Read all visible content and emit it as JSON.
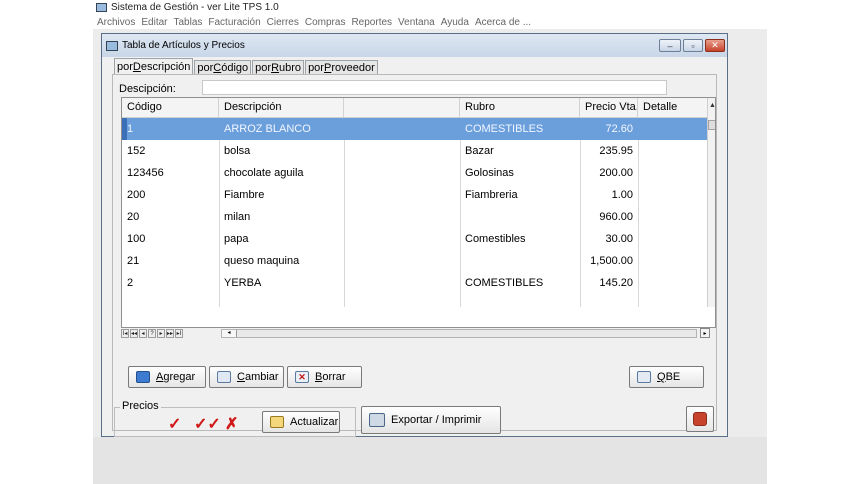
{
  "app": {
    "title": "Sistema de Gestión - ver Lite TPS 1.0",
    "menu": [
      "Archivos",
      "Editar",
      "Tablas",
      "Facturación",
      "Cierres",
      "Compras",
      "Reportes",
      "Ventana",
      "Ayuda",
      "Acerca de ..."
    ]
  },
  "window": {
    "title": "Tabla de Artículos y Precios",
    "controls": {
      "minimize": "–",
      "restore": "▫",
      "close": "✕"
    }
  },
  "tabs": [
    {
      "prefix": "por ",
      "key": "D",
      "rest": "escripción"
    },
    {
      "prefix": "por ",
      "key": "C",
      "rest": "ódigo"
    },
    {
      "prefix": "por ",
      "key": "R",
      "rest": "ubro"
    },
    {
      "prefix": "por ",
      "key": "P",
      "rest": "roveedor"
    }
  ],
  "search": {
    "label": "Descipción:",
    "value": ""
  },
  "table": {
    "columns": [
      "Código",
      "Descripción",
      "",
      "Rubro",
      "Precio Vta.",
      "Detalle"
    ],
    "rows": [
      [
        "1",
        "ARROZ BLANCO",
        "",
        "COMESTIBLES",
        "72.60",
        ""
      ],
      [
        "152",
        "bolsa",
        "",
        "Bazar",
        "235.95",
        ""
      ],
      [
        "123456",
        "chocolate aguila",
        "",
        "Golosinas",
        "200.00",
        ""
      ],
      [
        "200",
        "Fiambre",
        "",
        "Fiambreria",
        "1.00",
        ""
      ],
      [
        "20",
        "milan",
        "",
        "",
        "960.00",
        ""
      ],
      [
        "100",
        "papa",
        "",
        "Comestibles",
        "30.00",
        ""
      ],
      [
        "21",
        "queso maquina",
        "",
        "",
        "1,500.00",
        ""
      ],
      [
        "2",
        "YERBA",
        "",
        "COMESTIBLES",
        "145.20",
        ""
      ]
    ],
    "selected_row": 0
  },
  "navigator": {
    "first": "I◂",
    "prev_page": "◂◂",
    "prev": "◂",
    "record": "?",
    "next": "▸",
    "next_page": "▸▸",
    "last": "▸I"
  },
  "buttons": {
    "agregar": {
      "key": "A",
      "rest": "gregar"
    },
    "cambiar": {
      "key": "C",
      "rest": "ambiar"
    },
    "borrar": {
      "key": "B",
      "rest": "orrar"
    },
    "qbe": {
      "key": "Q",
      "rest": "BE"
    }
  },
  "precios": {
    "label": "Precios",
    "marks": [
      "✓",
      "✓✓",
      "✗"
    ],
    "actualizar": "Actualizar"
  },
  "exportar": "Exportar / Imprimir",
  "colors": {
    "selection": "#6b9fdc",
    "mark": "#d01818",
    "close": "#c8432b"
  }
}
